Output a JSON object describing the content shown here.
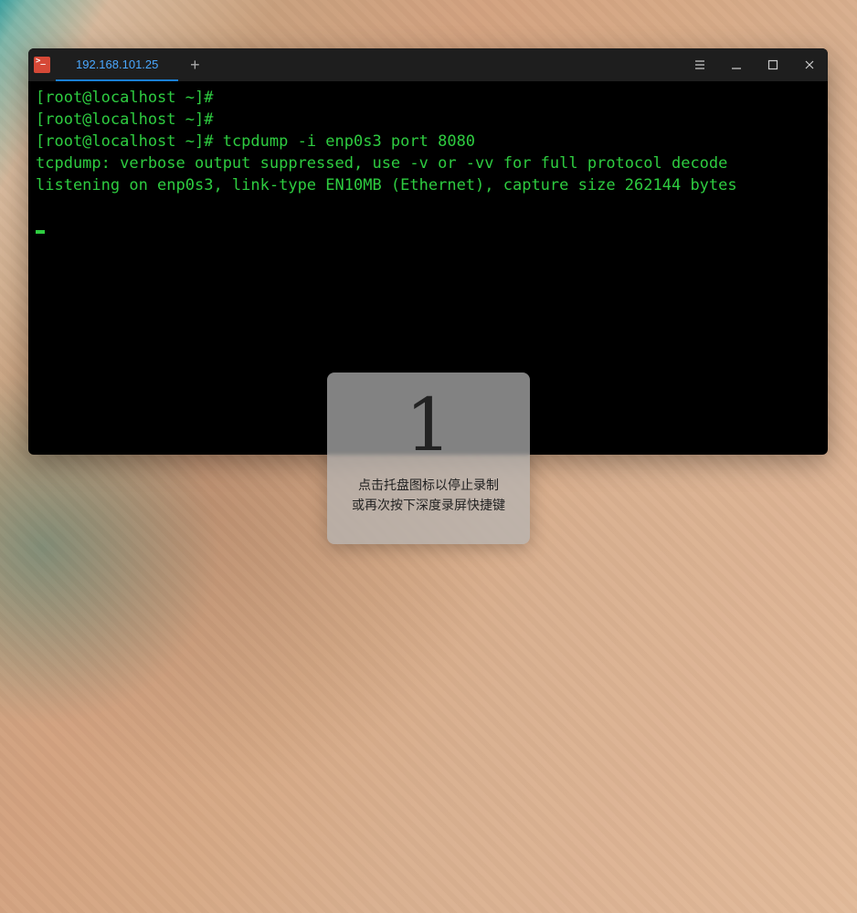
{
  "window": {
    "tab_title": "192.168.101.25",
    "new_tab_symbol": "+"
  },
  "terminal": {
    "lines": [
      {
        "parts": [
          {
            "text": "[root@localhost ~]#",
            "cls": "prompt"
          }
        ]
      },
      {
        "parts": [
          {
            "text": "[root@localhost ~]#",
            "cls": "prompt"
          }
        ]
      },
      {
        "parts": [
          {
            "text": "[root@localhost ~]# ",
            "cls": "prompt"
          },
          {
            "text": "tcpdump -i enp0s3 port 8080",
            "cls": "cmd"
          }
        ]
      },
      {
        "parts": [
          {
            "text": "tcpdump: verbose output suppressed, use -v or -vv for full protocol decode",
            "cls": "out"
          }
        ]
      },
      {
        "parts": [
          {
            "text": "listening on enp0s3, link-type EN10MB (Ethernet), capture size 262144 bytes",
            "cls": "out"
          }
        ]
      }
    ]
  },
  "overlay": {
    "countdown": "1",
    "line1": "点击托盘图标以停止录制",
    "line2": "或再次按下深度录屏快捷键"
  }
}
